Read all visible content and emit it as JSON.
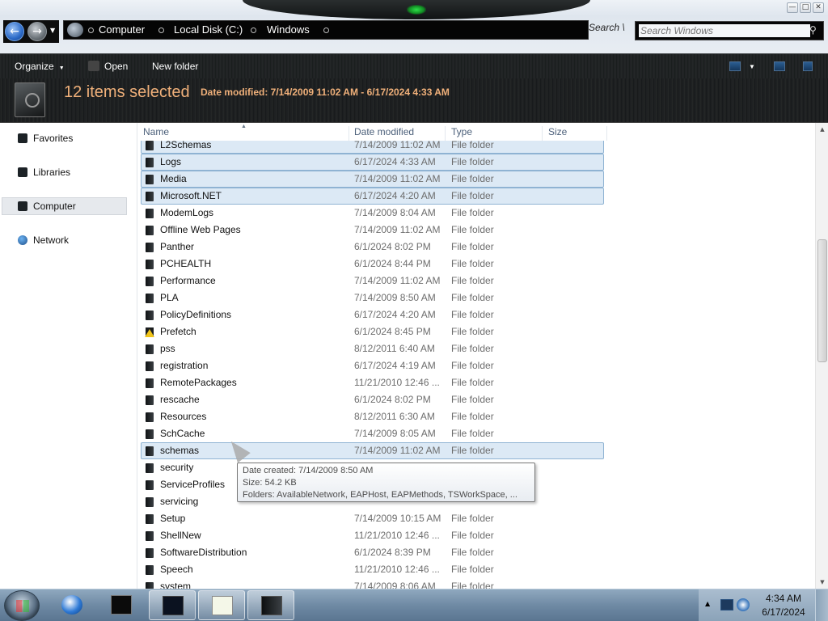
{
  "window": {
    "minimize_glyph": "—",
    "maximize_glyph": "□",
    "close_glyph": "✕"
  },
  "nav": {
    "back_icon": "←",
    "forward_icon": "→",
    "dropdown_icon": "▼"
  },
  "address": {
    "crumbs": [
      "Computer",
      "Local Disk (C:)",
      "Windows"
    ],
    "refresh_label": "Search \\"
  },
  "search": {
    "placeholder": "Search Windows",
    "icon": "search-icon"
  },
  "toolbar": {
    "organize_label": "Organize",
    "organize_dropdown": "▼",
    "open_label": "Open",
    "new_folder_label": "New folder",
    "views_dropdown": "▼"
  },
  "details": {
    "title": "12 items selected",
    "date_modified": "Date modified: 7/14/2009 11:02 AM - 6/17/2024 4:33 AM"
  },
  "sidebar": {
    "items": [
      {
        "label": "Favorites",
        "icon": "star-icon"
      },
      {
        "label": "Libraries",
        "icon": "library-icon"
      },
      {
        "label": "Computer",
        "icon": "computer-icon"
      },
      {
        "label": "Network",
        "icon": "network-icon"
      }
    ],
    "selected": "Computer"
  },
  "columns": {
    "name": "Name",
    "date_modified": "Date modified",
    "type": "Type",
    "size": "Size",
    "sort_indicator": "▲"
  },
  "files": [
    {
      "name": "L2Schemas",
      "date": "7/14/2009 11:02 AM",
      "type": "File folder",
      "selected": true
    },
    {
      "name": "Logs",
      "date": "6/17/2024 4:33 AM",
      "type": "File folder",
      "selected": true
    },
    {
      "name": "Media",
      "date": "7/14/2009 11:02 AM",
      "type": "File folder",
      "selected": true
    },
    {
      "name": "Microsoft.NET",
      "date": "6/17/2024 4:20 AM",
      "type": "File folder",
      "selected": true
    },
    {
      "name": "ModemLogs",
      "date": "7/14/2009 8:04 AM",
      "type": "File folder",
      "selected": false
    },
    {
      "name": "Offline Web Pages",
      "date": "7/14/2009 11:02 AM",
      "type": "File folder",
      "selected": false
    },
    {
      "name": "Panther",
      "date": "6/1/2024 8:02 PM",
      "type": "File folder",
      "selected": false
    },
    {
      "name": "PCHEALTH",
      "date": "6/1/2024 8:44 PM",
      "type": "File folder",
      "selected": false
    },
    {
      "name": "Performance",
      "date": "7/14/2009 11:02 AM",
      "type": "File folder",
      "selected": false
    },
    {
      "name": "PLA",
      "date": "7/14/2009 8:50 AM",
      "type": "File folder",
      "selected": false
    },
    {
      "name": "PolicyDefinitions",
      "date": "6/17/2024 4:20 AM",
      "type": "File folder",
      "selected": false
    },
    {
      "name": "Prefetch",
      "date": "6/1/2024 8:45 PM",
      "type": "File folder",
      "selected": false,
      "warning": true
    },
    {
      "name": "pss",
      "date": "8/12/2011 6:40 AM",
      "type": "File folder",
      "selected": false
    },
    {
      "name": "registration",
      "date": "6/17/2024 4:19 AM",
      "type": "File folder",
      "selected": false
    },
    {
      "name": "RemotePackages",
      "date": "11/21/2010 12:46 ...",
      "type": "File folder",
      "selected": false
    },
    {
      "name": "rescache",
      "date": "6/1/2024 8:02 PM",
      "type": "File folder",
      "selected": false
    },
    {
      "name": "Resources",
      "date": "8/12/2011 6:30 AM",
      "type": "File folder",
      "selected": false
    },
    {
      "name": "SchCache",
      "date": "7/14/2009 8:05 AM",
      "type": "File folder",
      "selected": false
    },
    {
      "name": "schemas",
      "date": "7/14/2009 11:02 AM",
      "type": "File folder",
      "selected": true
    },
    {
      "name": "security",
      "date": "",
      "type": "",
      "selected": false
    },
    {
      "name": "ServiceProfiles",
      "date": "",
      "type": "",
      "selected": false
    },
    {
      "name": "servicing",
      "date": "",
      "type": "",
      "selected": false
    },
    {
      "name": "Setup",
      "date": "7/14/2009 10:15 AM",
      "type": "File folder",
      "selected": false
    },
    {
      "name": "ShellNew",
      "date": "11/21/2010 12:46 ...",
      "type": "File folder",
      "selected": false
    },
    {
      "name": "SoftwareDistribution",
      "date": "6/1/2024 8:39 PM",
      "type": "File folder",
      "selected": false
    },
    {
      "name": "Speech",
      "date": "11/21/2010 12:46 ...",
      "type": "File folder",
      "selected": false
    },
    {
      "name": "system",
      "date": "7/14/2009 8:06 AM",
      "type": "File folder",
      "selected": false
    }
  ],
  "tooltip": {
    "created": "Date created: 7/14/2009 8:50 AM",
    "size": "Size: 54.2 KB",
    "folders": "Folders: AvailableNetwork, EAPHost, EAPMethods, TSWorkSpace, ..."
  },
  "scrollbar": {
    "up": "▲",
    "down": "▼"
  },
  "taskbar": {
    "items": [
      "windows-media-player",
      "command-prompt",
      "resource-monitor",
      "notepad",
      "windows-explorer"
    ],
    "tray_expand": "▲",
    "time": "4:34 AM",
    "date": "6/17/2024"
  }
}
